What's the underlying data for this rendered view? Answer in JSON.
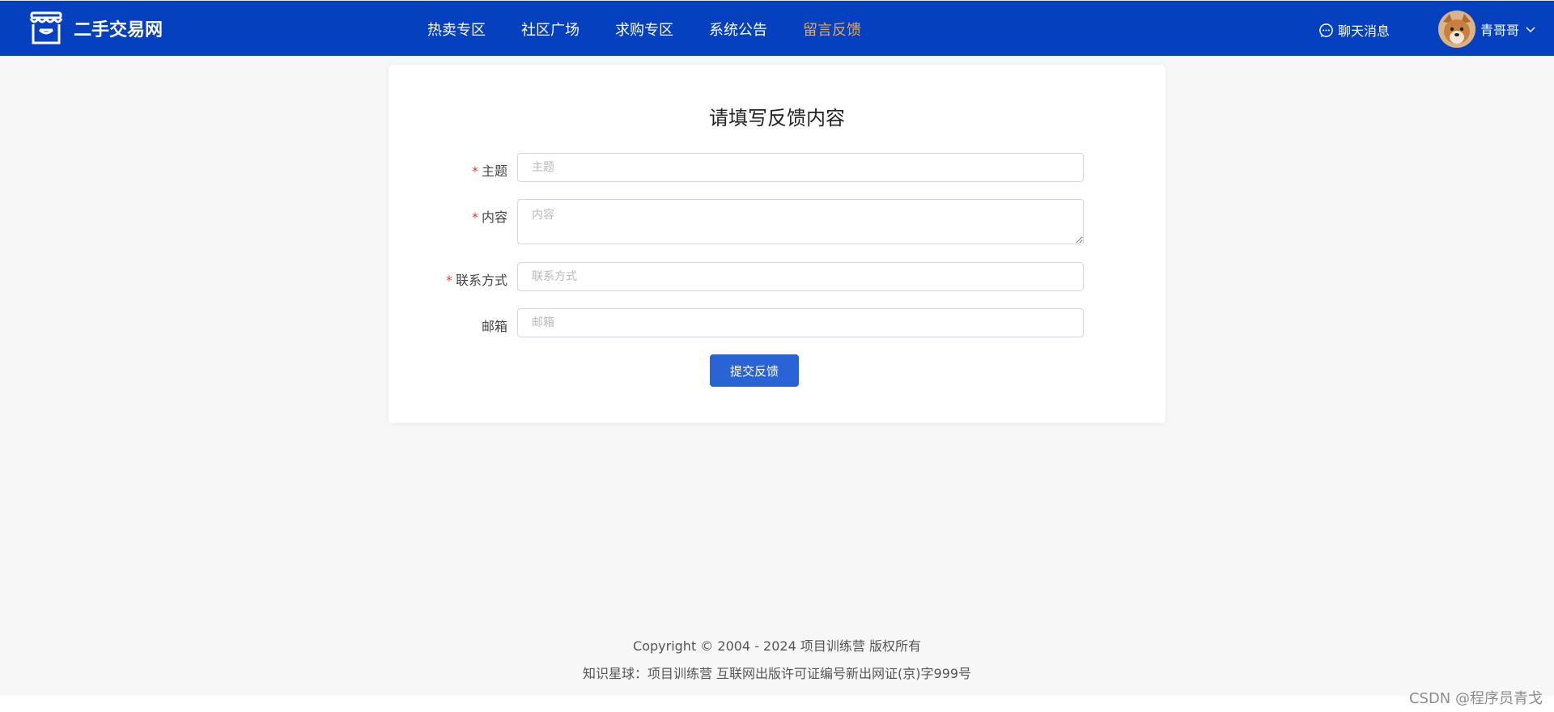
{
  "header": {
    "logo_text": "二手交易网",
    "nav": [
      {
        "label": "热卖专区",
        "active": false
      },
      {
        "label": "社区广场",
        "active": false
      },
      {
        "label": "求购专区",
        "active": false
      },
      {
        "label": "系统公告",
        "active": false
      },
      {
        "label": "留言反馈",
        "active": true
      }
    ],
    "chat_label": "聊天消息",
    "username": "青哥哥",
    "colors": {
      "bar": "#0540bf",
      "active_nav": "#f5a742"
    }
  },
  "form": {
    "title": "请填写反馈内容",
    "required_mark": "*",
    "fields": {
      "subject": {
        "label": "主题",
        "placeholder": "主题",
        "value": "",
        "required": true
      },
      "content": {
        "label": "内容",
        "placeholder": "内容",
        "value": "",
        "required": true
      },
      "contact": {
        "label": "联系方式",
        "placeholder": "联系方式",
        "value": "",
        "required": true
      },
      "email": {
        "label": "邮箱",
        "placeholder": "邮箱",
        "value": "",
        "required": false
      }
    },
    "submit_label": "提交反馈"
  },
  "footer": {
    "copyright": "Copyright © 2004 - 2024 项目训练营 版权所有",
    "license": "知识星球：项目训练营 互联网出版许可证编号新出网证(京)字999号"
  },
  "watermark": "CSDN @程序员青戈"
}
